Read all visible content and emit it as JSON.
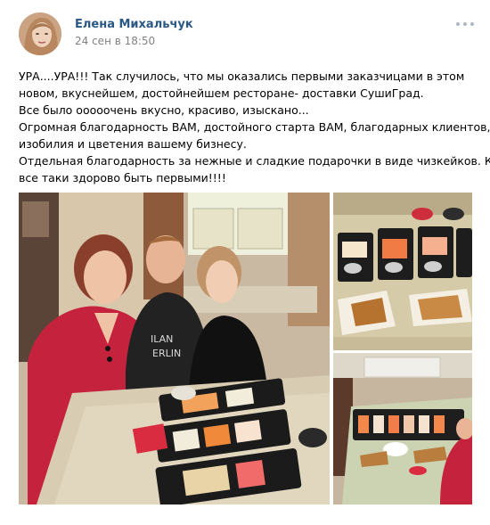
{
  "post": {
    "author": "Елена Михальчук",
    "date": "24 сен в 18:50",
    "menu_icon": "more-horizontal-icon",
    "text_lines": [
      "УРА....УРА!!! Так случилось, что мы оказались первыми заказчицами в этом",
      "новом, вкуснейшем, достойнейшем ресторане- доставки СушиГрад.",
      "Все было ооооочень вкусно, красиво, изыскано...",
      "Огромная благодарность ВАМ, достойного старта ВАМ, благодарных клиентов,",
      "изобилия и цветения вашему бизнесу.",
      "Отдельная благодарность за нежные и сладкие подарочки в виде чизкейков. Как",
      "все таки здорово быть первыми!!!!"
    ]
  },
  "colors": {
    "author_link": "#2a5885",
    "date": "#828282",
    "menu_dots": "#aeb7c2"
  }
}
